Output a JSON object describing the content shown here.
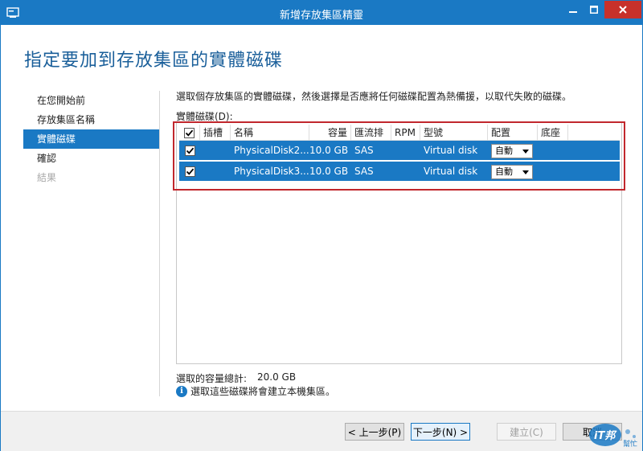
{
  "window": {
    "title": "新增存放集區精靈",
    "minimize_label": "—",
    "maximize_label": "□",
    "close_label": "✕"
  },
  "page": {
    "heading": "指定要加到存放集區的實體磁碟",
    "description": "選取個存放集區的實體磁碟，然後選擇是否應將任何磁碟配置為熱備援，以取代失敗的磁碟。",
    "disks_label": "實體磁碟(D):"
  },
  "nav": {
    "items": [
      {
        "label": "在您開始前",
        "state": "normal"
      },
      {
        "label": "存放集區名稱",
        "state": "normal"
      },
      {
        "label": "實體磁碟",
        "state": "active"
      },
      {
        "label": "確認",
        "state": "normal"
      },
      {
        "label": "結果",
        "state": "disabled"
      }
    ]
  },
  "grid": {
    "columns": [
      "插槽",
      "名稱",
      "容量",
      "匯流排",
      "RPM",
      "型號",
      "配置",
      "底座"
    ],
    "rows": [
      {
        "checked": true,
        "slot": "",
        "name": "PhysicalDisk2...",
        "capacity": "10.0 GB",
        "bus": "SAS",
        "rpm": "",
        "model": "Virtual disk",
        "allocation": "自動",
        "chassis": ""
      },
      {
        "checked": true,
        "slot": "",
        "name": "PhysicalDisk3...",
        "capacity": "10.0 GB",
        "bus": "SAS",
        "rpm": "",
        "model": "Virtual disk",
        "allocation": "自動",
        "chassis": ""
      }
    ]
  },
  "summary": {
    "capacity_label": "選取的容量總計:",
    "capacity_value": "20.0 GB",
    "info_text": "選取這些磁碟將會建立本機集區。"
  },
  "footer": {
    "prev_label": "< 上一步(P)",
    "next_label": "下一步(N) >",
    "create_label": "建立(C)",
    "cancel_label": "取消"
  },
  "watermark": {
    "brand": "iT邦",
    "sub": "幫忙"
  },
  "colors": {
    "accent": "#1a79c4",
    "highlight_border": "#c1272d",
    "heading": "#1a5f9a",
    "close": "#c7312b"
  }
}
